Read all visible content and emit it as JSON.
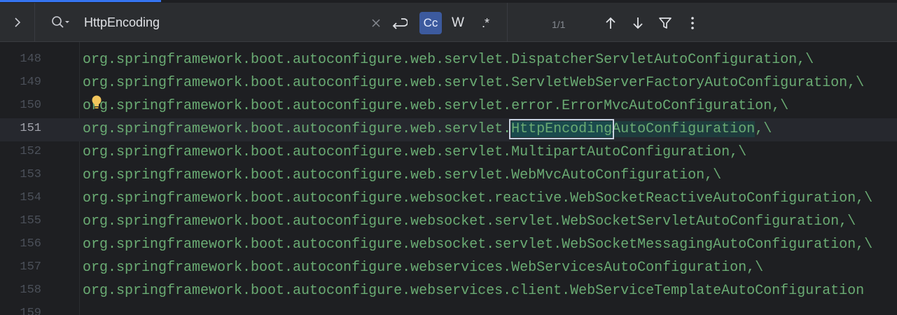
{
  "find": {
    "query": "HttpEncoding",
    "match_count": "1/1",
    "case_label": "Cc",
    "words_label": "W",
    "regex_label": ".*"
  },
  "editor": {
    "lines": [
      {
        "num": "148",
        "code": "org.springframework.boot.autoconfigure.web.servlet.DispatcherServletAutoConfiguration,\\"
      },
      {
        "num": "149",
        "code": "org.springframework.boot.autoconfigure.web.servlet.ServletWebServerFactoryAutoConfiguration,\\"
      },
      {
        "num": "150",
        "code": "org.springframework.boot.autoconfigure.web.servlet.error.ErrorMvcAutoConfiguration,\\"
      },
      {
        "num": "151",
        "prefix": "org.springframework.boot.autoconfigure.web.servlet.",
        "match": "HttpEncoding",
        "suffix": "AutoConfiguration",
        "tail": ",\\"
      },
      {
        "num": "152",
        "code": "org.springframework.boot.autoconfigure.web.servlet.MultipartAutoConfiguration,\\"
      },
      {
        "num": "153",
        "code": "org.springframework.boot.autoconfigure.web.servlet.WebMvcAutoConfiguration,\\"
      },
      {
        "num": "154",
        "code": "org.springframework.boot.autoconfigure.websocket.reactive.WebSocketReactiveAutoConfiguration,\\"
      },
      {
        "num": "155",
        "code": "org.springframework.boot.autoconfigure.websocket.servlet.WebSocketServletAutoConfiguration,\\"
      },
      {
        "num": "156",
        "code": "org.springframework.boot.autoconfigure.websocket.servlet.WebSocketMessagingAutoConfiguration,\\"
      },
      {
        "num": "157",
        "code": "org.springframework.boot.autoconfigure.webservices.WebServicesAutoConfiguration,\\"
      },
      {
        "num": "158",
        "code": "org.springframework.boot.autoconfigure.webservices.client.WebServiceTemplateAutoConfiguration"
      },
      {
        "num": "159",
        "code": ""
      }
    ]
  }
}
